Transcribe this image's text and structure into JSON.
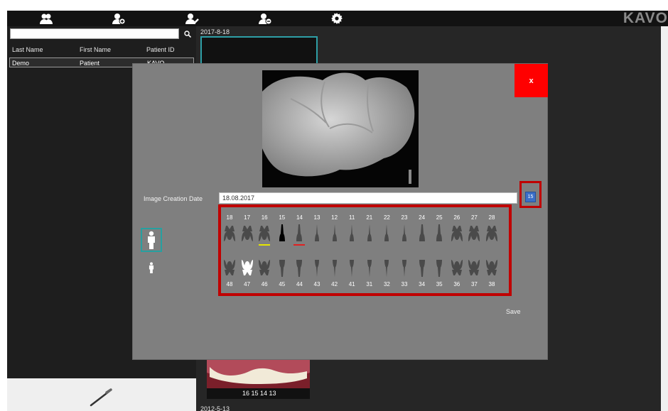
{
  "app": {
    "logo": "KAVO"
  },
  "toolbar": {
    "icons": [
      "patients-icon",
      "add-patient-icon",
      "edit-patient-icon",
      "remove-patient-icon",
      "gear-icon"
    ]
  },
  "patient_list": {
    "search_value": "",
    "columns": [
      "Last Name",
      "First Name",
      "Patient ID"
    ],
    "rows": [
      {
        "last": "Demo",
        "first": "Patient",
        "id": "KAVO"
      }
    ]
  },
  "gallery": {
    "dates": [
      "2017-8-18",
      "2012-5-13"
    ],
    "photo_caption": "16 15 14 13"
  },
  "dialog": {
    "close_label": "x",
    "date_label": "Image Creation Date",
    "date_value": "18.08.2017",
    "calendar_label": "15",
    "save_label": "Save",
    "upper_teeth": [
      "18",
      "17",
      "16",
      "15",
      "14",
      "13",
      "12",
      "11",
      "21",
      "22",
      "23",
      "24",
      "25",
      "26",
      "27",
      "28"
    ],
    "lower_teeth": [
      "48",
      "47",
      "46",
      "45",
      "44",
      "43",
      "42",
      "41",
      "31",
      "32",
      "33",
      "34",
      "35",
      "36",
      "37",
      "38"
    ],
    "highlight_colors": {
      "16": "#e6e600",
      "14": "#e02020"
    },
    "selected_upper": [
      "15"
    ],
    "selected_lower": [
      "47"
    ],
    "frame_color": "#c00000",
    "accent": "#ff0000"
  }
}
